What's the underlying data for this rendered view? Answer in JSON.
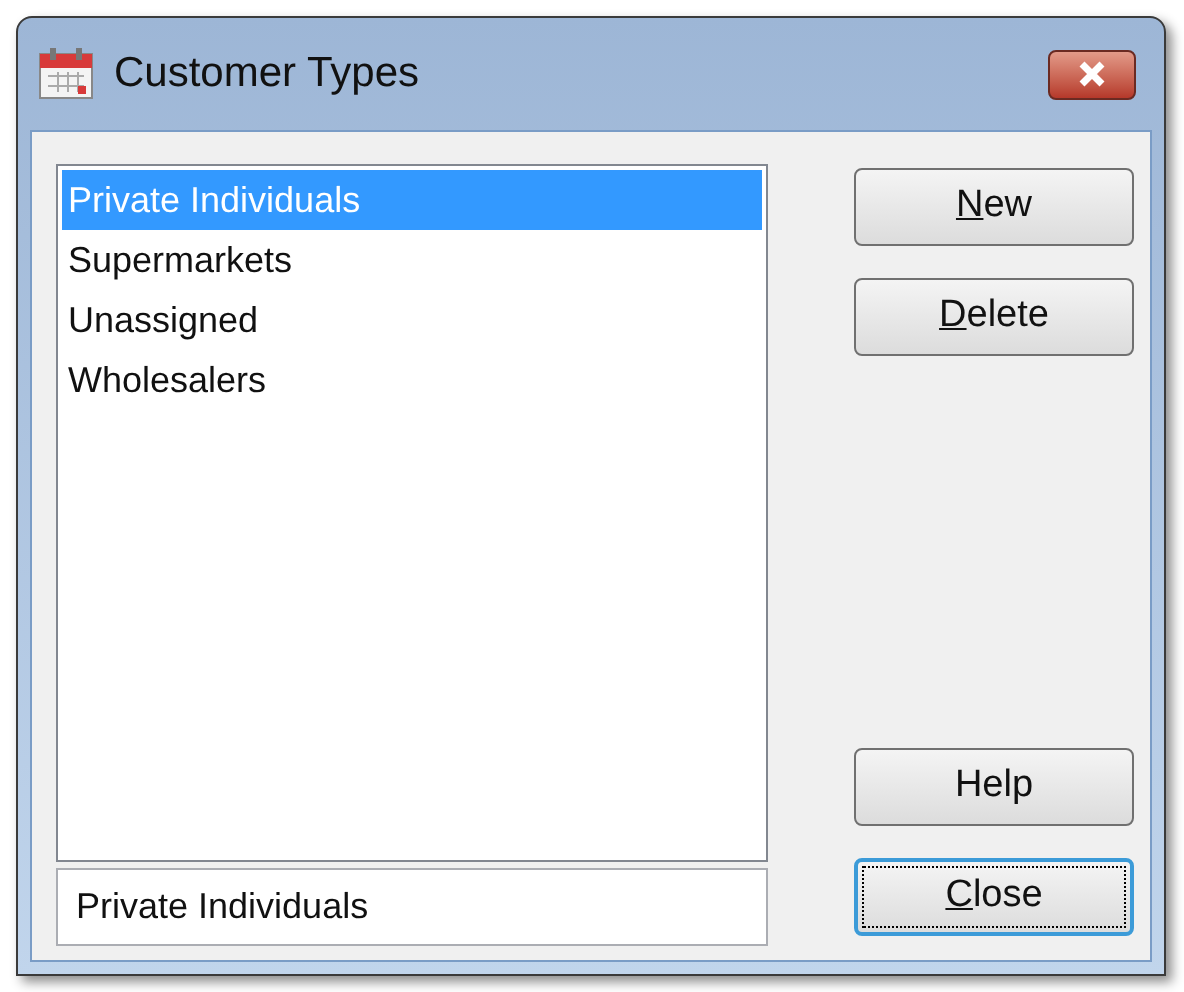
{
  "window": {
    "title": "Customer Types"
  },
  "list": {
    "items": [
      {
        "label": "Private Individuals",
        "selected": true
      },
      {
        "label": "Supermarkets",
        "selected": false
      },
      {
        "label": "Unassigned",
        "selected": false
      },
      {
        "label": "Wholesalers",
        "selected": false
      }
    ]
  },
  "name_field": {
    "value": "Private Individuals"
  },
  "buttons": [
    {
      "label": "New",
      "underline_first": true,
      "focused": false
    },
    {
      "label": "Delete",
      "underline_first": true,
      "focused": false
    },
    {
      "label": "Help",
      "underline_first": false,
      "focused": false
    },
    {
      "label": "Close",
      "underline_first": true,
      "focused": true
    }
  ]
}
